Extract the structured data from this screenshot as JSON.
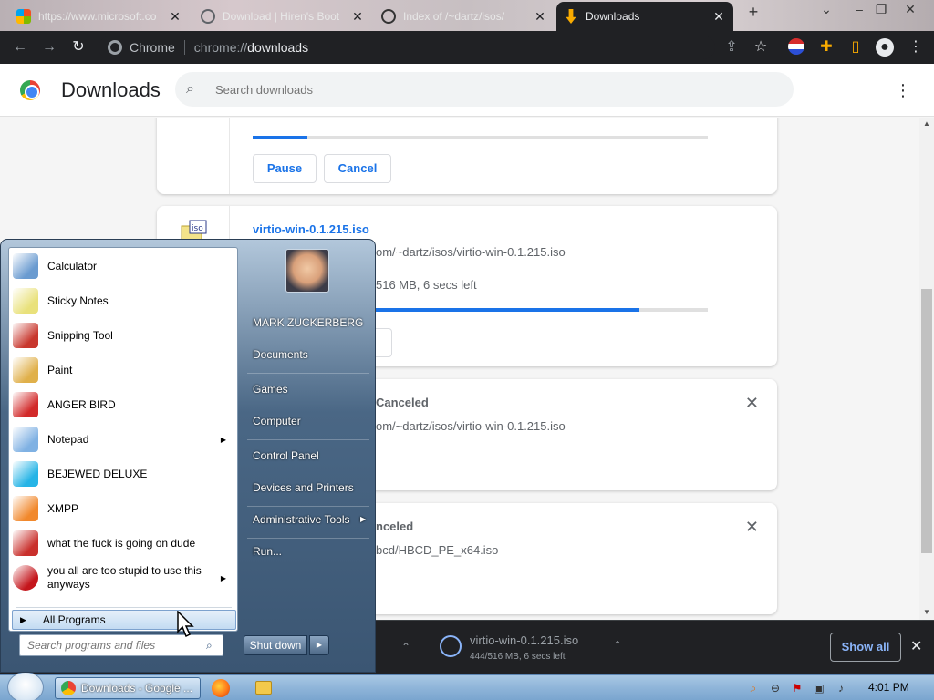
{
  "tabs": [
    {
      "title": "https://www.microsoft.co",
      "active": false
    },
    {
      "title": "Download | Hiren's Boot",
      "active": false
    },
    {
      "title": "Index of /~dartz/isos/",
      "active": false
    },
    {
      "title": "Downloads",
      "active": true
    }
  ],
  "tab_new_label": "+",
  "window_controls": {
    "minimize": "–",
    "maximize": "❐",
    "close": "✕"
  },
  "omnibox": {
    "chip": "Chrome",
    "scheme": "chrome://",
    "path": "downloads"
  },
  "header": {
    "title": "Downloads",
    "search_placeholder": "Search downloads"
  },
  "cards": [
    {
      "pause_label": "Pause",
      "cancel_label": "Cancel",
      "progress": 0.12
    },
    {
      "filename": "virtio-win-0.1.215.iso",
      "url_fragment": "om/~dartz/isos/virtio-win-0.1.215.iso",
      "status": "516 MB, 6 secs left",
      "progress": 0.85
    },
    {
      "status_bold": "Canceled",
      "url_fragment": "om/~dartz/isos/virtio-win-0.1.215.iso"
    },
    {
      "status_bold": "nceled",
      "url_fragment": "bcd/HBCD_PE_x64.iso"
    }
  ],
  "shelf": {
    "item_name": "virtio-win-0.1.215.iso",
    "item_progress": "444/516 MB, 6 secs left",
    "show_all": "Show all"
  },
  "start_menu": {
    "programs": [
      {
        "label": "Calculator",
        "color": "#6a9bd0"
      },
      {
        "label": "Sticky Notes",
        "color": "#e9e17b"
      },
      {
        "label": "Snipping Tool",
        "color": "#c8372d"
      },
      {
        "label": "Paint",
        "color": "#e0b04a"
      },
      {
        "label": "ANGER BIRD",
        "color": "#d22a2a"
      },
      {
        "label": "Notepad",
        "color": "#7fb1e3"
      },
      {
        "label": "BEJEWED DELUXE",
        "color": "#26b4e6"
      },
      {
        "label": "XMPP",
        "color": "#f1882c"
      },
      {
        "label": "what the fuck is going on dude",
        "color": "#c9302c"
      },
      {
        "label": "you all are too stupid to use this anyways",
        "color": "#c4161c"
      }
    ],
    "all_programs": "All Programs",
    "search_placeholder": "Search programs and files",
    "right": [
      "MARK ZUCKERBERG",
      "Documents",
      "Games",
      "Computer",
      "Control Panel",
      "Devices and Printers",
      "Administrative Tools",
      "Run..."
    ],
    "shutdown": "Shut down"
  },
  "taskbar": {
    "chrome_label": "Downloads - Google ...",
    "clock": "4:01 PM"
  }
}
